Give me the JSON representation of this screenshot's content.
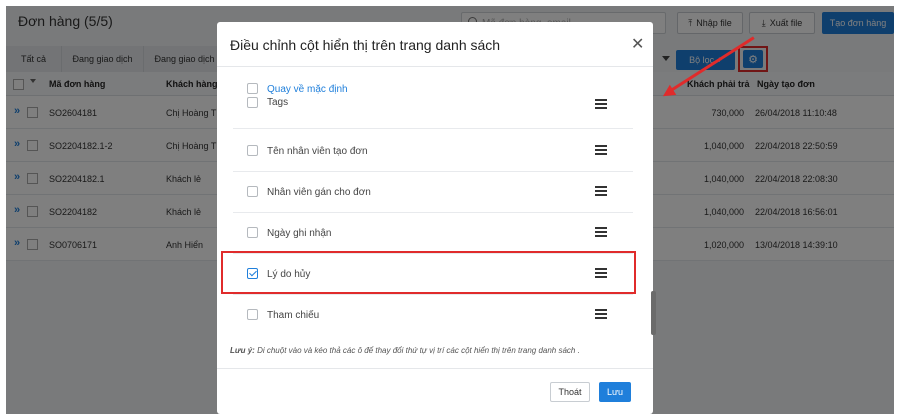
{
  "page": {
    "title": "Đơn hàng (5/5)",
    "search_placeholder": "Mã đơn hàng, email...",
    "import_label": "Nhập file",
    "export_label": "Xuất file",
    "create_label": "Tạo đơn hàng"
  },
  "tabs": [
    {
      "label": "Tất cả"
    },
    {
      "label": "Đang giao dịch"
    },
    {
      "label": "Đang giao dịch"
    }
  ],
  "toolbar": {
    "filter_label": "Bộ lọc +",
    "filter_icon": "plus-icon",
    "settings_icon": "gear-icon"
  },
  "table": {
    "headers": {
      "order_code": "Mã đơn hàng",
      "customer": "Khách hàng",
      "payable": "Khách phải trả",
      "created": "Ngày tạo đơn"
    },
    "rows": [
      {
        "order_code": "SO2604181",
        "customer": "Chị Hoàng Th",
        "payable": "730,000",
        "created": "26/04/2018 11:10:48"
      },
      {
        "order_code": "SO2204182.1-2",
        "customer": "Chị Hoàng Th",
        "payable": "1,040,000",
        "created": "22/04/2018 22:50:59"
      },
      {
        "order_code": "SO2204182.1",
        "customer": "Khách lẻ",
        "payable": "1,040,000",
        "created": "22/04/2018 22:08:30"
      },
      {
        "order_code": "SO2204182",
        "customer": "Khách lẻ",
        "payable": "1,040,000",
        "created": "22/04/2018 16:56:01"
      },
      {
        "order_code": "SO0706171",
        "customer": "Anh Hiển",
        "payable": "1,020,000",
        "created": "13/04/2018 14:39:10"
      }
    ]
  },
  "modal": {
    "title": "Điều chỉnh cột hiển thị trên trang danh sách",
    "close_icon": "close-icon",
    "reset_label": "Quay về mặc định",
    "items": [
      {
        "label": "Tags",
        "checked": false
      },
      {
        "label": "Tên nhân viên tạo đơn",
        "checked": false
      },
      {
        "label": "Nhân viên gán cho đơn",
        "checked": false
      },
      {
        "label": "Ngày ghi nhận",
        "checked": false
      },
      {
        "label": "Lý do hủy",
        "checked": true
      },
      {
        "label": "Tham chiếu",
        "checked": false
      }
    ],
    "note_prefix": "Lưu ý:",
    "note_text": "Di chuột vào và kéo thả các ô để thay đổi thứ tự vị trí các cột hiển thị trên trang danh sách .",
    "exit_label": "Thoát",
    "save_label": "Lưu"
  },
  "colors": {
    "primary": "#1f7fdb",
    "highlight": "#e02b2b",
    "overlay": "rgba(0,0,0,0.5)"
  }
}
